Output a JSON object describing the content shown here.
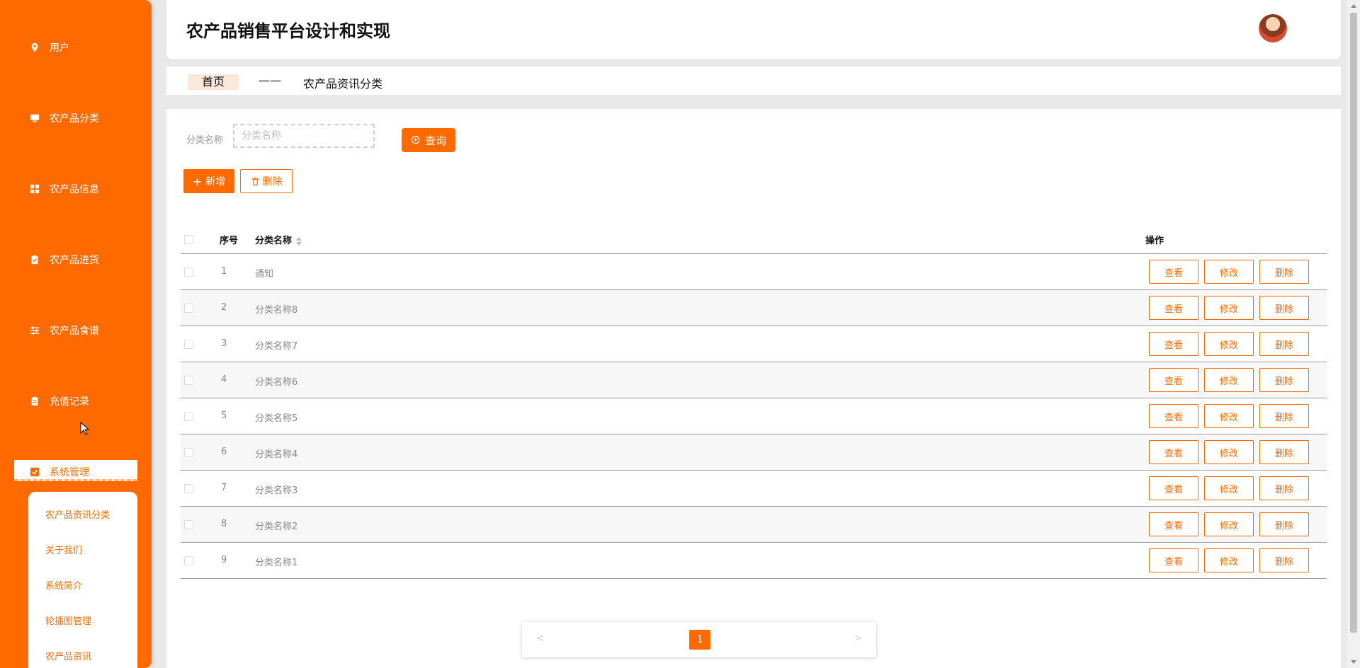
{
  "app": {
    "title": "农产品销售平台设计和实现"
  },
  "sidebar": {
    "items": [
      {
        "label": "用户",
        "icon": "location-pin-icon"
      },
      {
        "label": "农产品分类",
        "icon": "monitor-icon"
      },
      {
        "label": "农产品信息",
        "icon": "grid-icon"
      },
      {
        "label": "农产品进货",
        "icon": "clipboard-check-icon"
      },
      {
        "label": "农产品食谱",
        "icon": "sliders-icon"
      },
      {
        "label": "充值记录",
        "icon": "clipboard-icon"
      }
    ],
    "active": {
      "label": "系统管理",
      "icon": "checkbox-icon"
    },
    "submenu": [
      "农产品资讯分类",
      "关于我们",
      "系统简介",
      "轮播图管理",
      "农产品资讯"
    ]
  },
  "breadcrumb": {
    "home": "首页",
    "separator": "——",
    "current": "农产品资讯分类"
  },
  "search": {
    "label": "分类名称",
    "placeholder": "分类名称",
    "value": "",
    "query_button": "查询"
  },
  "toolbar": {
    "add_label": "新增",
    "delete_label": "删除"
  },
  "table": {
    "headers": {
      "no": "序号",
      "name": "分类名称",
      "op": "操作"
    },
    "actions": {
      "view": "查看",
      "edit": "修改",
      "delete": "删除"
    },
    "rows": [
      {
        "no": "1",
        "name": "通知"
      },
      {
        "no": "2",
        "name": "分类名称8"
      },
      {
        "no": "3",
        "name": "分类名称7"
      },
      {
        "no": "4",
        "name": "分类名称6"
      },
      {
        "no": "5",
        "name": "分类名称5"
      },
      {
        "no": "6",
        "name": "分类名称4"
      },
      {
        "no": "7",
        "name": "分类名称3"
      },
      {
        "no": "8",
        "name": "分类名称2"
      },
      {
        "no": "9",
        "name": "分类名称1"
      }
    ]
  },
  "pagination": {
    "prev": "<",
    "next": ">",
    "current_page": "1"
  },
  "colors": {
    "accent": "#ff6a00",
    "breadcrumb_home_bg": "#fde6da"
  }
}
